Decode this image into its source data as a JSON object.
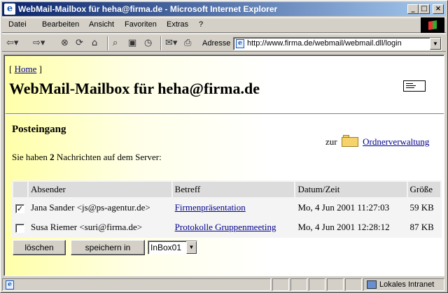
{
  "window": {
    "title": "WebMail-Mailbox für heha@firma.de - Microsoft Internet Explorer",
    "minimize": "_",
    "maximize": "□",
    "close": "×"
  },
  "menu": {
    "items": [
      {
        "label": "Datei"
      },
      {
        "label": "Bearbeiten"
      },
      {
        "label": "Ansicht"
      },
      {
        "label": "Favoriten"
      },
      {
        "label": "Extras"
      },
      {
        "label": "?"
      }
    ]
  },
  "toolbar": {
    "address_label": "Adresse",
    "address_value": "http://www.firma.de/webmail/webmail.dll/login"
  },
  "page": {
    "home_link": "Home",
    "heading": "WebMail-Mailbox für heha@firma.de",
    "inbox_heading": "Posteingang",
    "folder_prefix": "zur",
    "folder_link": "Ordnerverwaltung",
    "info_before": "Sie haben",
    "message_count": "2",
    "info_after": "Nachrichten auf dem Server:",
    "columns": {
      "sender": "Absender",
      "subject": "Betreff",
      "date": "Datum/Zeit",
      "size": "Größe"
    },
    "messages": [
      {
        "checked": true,
        "sender": "Jana Sander <js@ps-agentur.de>",
        "subject": "Firmenpräsentation",
        "date": "Mo, 4 Jun 2001 11:27:03",
        "size": "59 KB"
      },
      {
        "checked": false,
        "sender": "Susa Riemer <suri@firma.de>",
        "subject": "Protokolle Gruppenmeeting",
        "date": "Mo, 4 Jun 2001 12:28:12",
        "size": "87 KB"
      }
    ],
    "delete_button": "löschen",
    "save_button": "speichern in",
    "folder_select": "InBox01"
  },
  "status": {
    "zone": "Lokales Intranet"
  }
}
